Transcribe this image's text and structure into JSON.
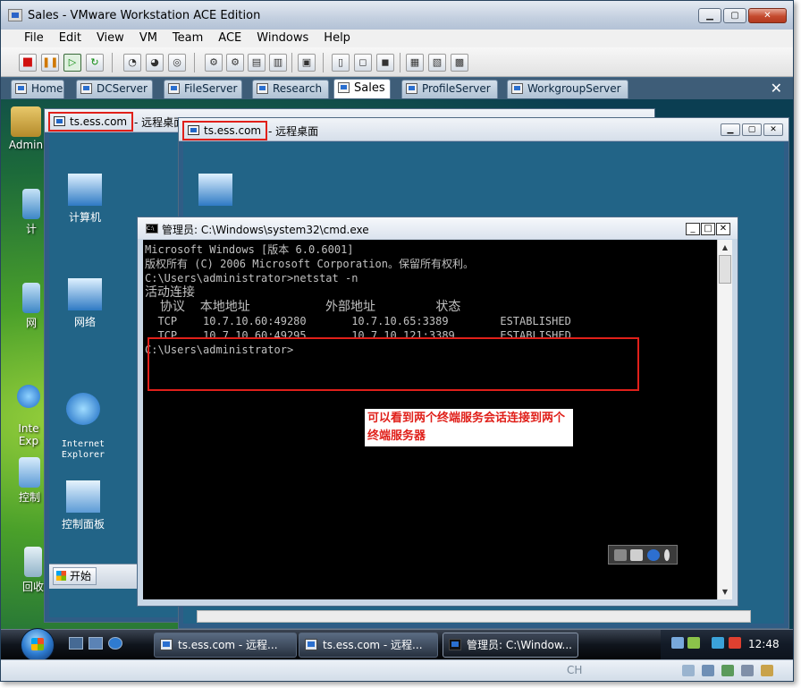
{
  "window": {
    "title": "Sales - VMware Workstation ACE Edition",
    "minimize": "▁",
    "maximize": "▢",
    "close": "✕"
  },
  "menu": [
    "File",
    "Edit",
    "View",
    "VM",
    "Team",
    "ACE",
    "Windows",
    "Help"
  ],
  "tabs": [
    {
      "label": "Home"
    },
    {
      "label": "DCServer"
    },
    {
      "label": "FileServer"
    },
    {
      "label": "Research"
    },
    {
      "label": "Sales",
      "active": true
    },
    {
      "label": "ProfileServer"
    },
    {
      "label": "WorkgroupServer"
    }
  ],
  "tab_close": "✕",
  "guest_desktop": {
    "icons": [
      "Admin",
      "计",
      "网",
      "Inte\nExp",
      "控制",
      "回收"
    ],
    "taskbar": {
      "buttons": [
        {
          "label": "ts.ess.com - 远程..."
        },
        {
          "label": "ts.ess.com - 远程..."
        },
        {
          "label": "管理员: C:\\Window..."
        }
      ],
      "clock": "12:48"
    },
    "langbar": {
      "label": "CH"
    }
  },
  "rdp_back": {
    "title": "ts.ess.com",
    "subtitle": "- 远程桌面",
    "icons": [
      "计算机",
      "网络",
      "Internet\nExplorer",
      "控制面板"
    ],
    "start_label": "开始"
  },
  "rdp_front": {
    "title": "ts.ess.com",
    "subtitle": "- 远程桌面"
  },
  "cmd": {
    "title": "管理员: C:\\Windows\\system32\\cmd.exe",
    "icon_text": "C:\\",
    "lines": [
      "Microsoft Windows [版本 6.0.6001]",
      "版权所有 (C) 2006 Microsoft Corporation。保留所有权利。",
      "",
      "C:\\Users\\administrator>netstat -n",
      "",
      "活动连接",
      "",
      "  协议  本地地址          外部地址        状态",
      "  TCP    10.7.10.60:49280       10.7.10.65:3389        ESTABLISHED",
      "  TCP    10.7.10.60:49295       10.7.10.121:3389       ESTABLISHED",
      "",
      "C:\\Users\\administrator>"
    ]
  },
  "annotation": {
    "text": "可以看到两个终端服务会话连接到两个终端服务器"
  },
  "colors": {
    "highlight_red": "#e0201a",
    "titlebar": "#c3cfdf",
    "console_bg": "#000000",
    "console_fg": "#c0c0c0"
  }
}
